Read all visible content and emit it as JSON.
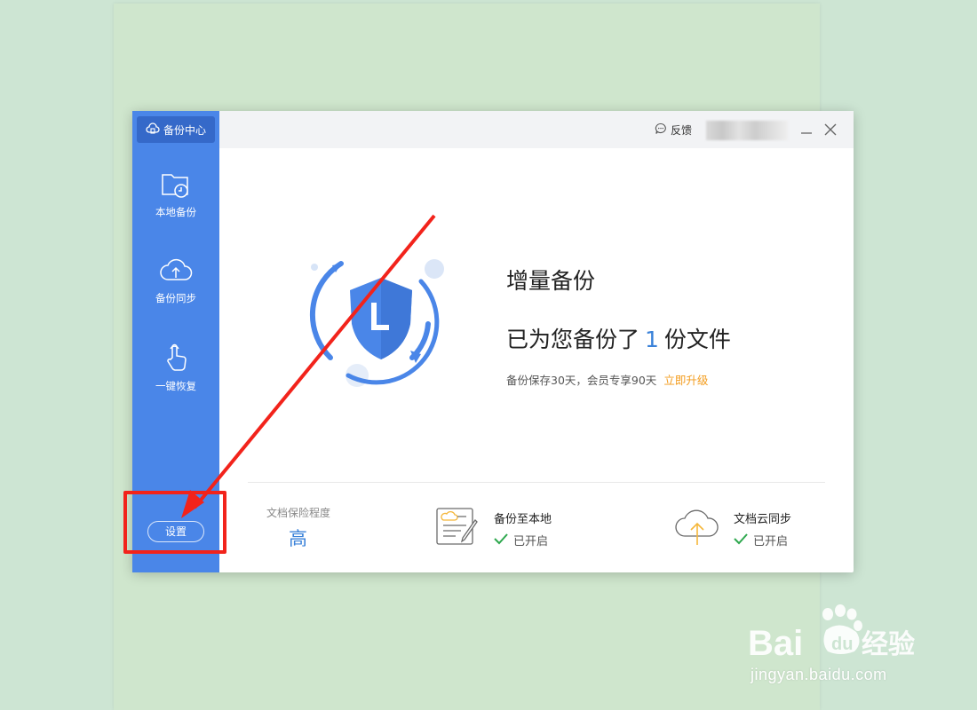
{
  "sidebar": {
    "header_label": "备份中心",
    "items": [
      {
        "label": "本地备份",
        "icon": "folder-clock-icon"
      },
      {
        "label": "备份同步",
        "icon": "cloud-upload-icon"
      },
      {
        "label": "一键恢复",
        "icon": "hand-pointer-icon"
      }
    ],
    "settings_label": "设置"
  },
  "titlebar": {
    "feedback_label": "反馈"
  },
  "hero": {
    "title": "增量备份",
    "subtitle_prefix": "已为您备份了",
    "count": "1",
    "subtitle_suffix": "份文件",
    "note": "备份保存30天，会员专享90天",
    "upgrade_link": "立即升级"
  },
  "stats": {
    "protection_label": "文档保险程度",
    "protection_level": "高"
  },
  "features": [
    {
      "title": "备份至本地",
      "status": "已开启",
      "icon": "document-edit-icon"
    },
    {
      "title": "文档云同步",
      "status": "已开启",
      "icon": "cloud-sync-icon"
    }
  ],
  "watermark": {
    "url": "jingyan.baidu.com",
    "brand_text": "Bai du 经验"
  },
  "colors": {
    "sidebar": "#4a86e8",
    "accent": "#3b82d9",
    "upgrade": "#f39b1b",
    "annotation": "#f2231b",
    "check": "#2fa84f"
  }
}
